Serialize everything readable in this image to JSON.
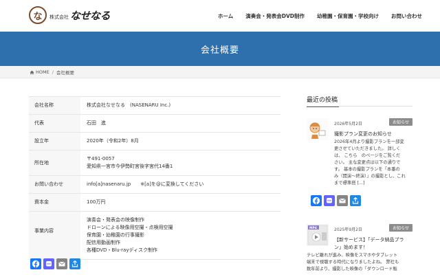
{
  "header": {
    "logo_mark": "な",
    "logo_sub": "株式会社",
    "logo_main": "なせなる",
    "nav": [
      "ホーム",
      "演奏会・発表会DVD制作",
      "幼稚園・保育園・学校向け",
      "お問い合わせ"
    ]
  },
  "banner": {
    "title": "会社概要"
  },
  "breadcrumb": {
    "home": "HOME",
    "sep": "/",
    "current": "会社概要"
  },
  "company": {
    "rows": [
      {
        "key": "会社名称",
        "values": [
          "株式会社なせなる　(NASENARU Inc.)"
        ]
      },
      {
        "key": "代表",
        "values": [
          "石田　進"
        ]
      },
      {
        "key": "設立年",
        "values": [
          "2020年（令和2年）8月"
        ]
      },
      {
        "key": "所在地",
        "values": [
          "〒491-0057",
          "愛知県一宮市今伊勢町宮後字宮代14番1"
        ]
      },
      {
        "key": "お問い合わせ",
        "values": [
          "info[a]nasenaru.jp　　※[a]を@に変換してください"
        ]
      },
      {
        "key": "資本金",
        "values": [
          "100万円"
        ]
      },
      {
        "key": "事業内容",
        "values": [
          "演奏会・発表会の映像制作",
          "ドローンによる映像用空撮・点検用空撮",
          "保育園・幼稚園の行事撮影",
          "配信用動画制作",
          "各種DVD・Blu-rayディスク制作"
        ]
      }
    ]
  },
  "share": [
    "facebook-icon",
    "mastodon-icon",
    "mail-icon",
    "share-icon"
  ],
  "sidebar": {
    "title": "最近の投稿",
    "posts": [
      {
        "date": "2026年5月2日",
        "badge": "お知らせ",
        "title": "撮影プラン変更のお知らせ",
        "excerpt": [
          "2026年4月より撮影プランを一部変",
          "更させていただきました。 詳しく",
          "は、 こちら　のページをご覧くだ",
          "さい。 主な変更点は以下の通りで",
          "す。 基本の撮影プランを「本番の",
          "み（開演〜終演）」の撮影とし、これ",
          "まで標準搭 [...]"
        ]
      },
      {
        "date": "2025年9月2日",
        "badge": "お知らせ",
        "title": "【新サービス】「データ納品プラ",
        "title2": "ン」始めます！",
        "thumb_label": "MP4",
        "excerpt": [
          "テレビ離れが進み、映像をスマホやタブレット",
          "端末で視聴する時代になりましたよね。 弊社も",
          "数年前より、撮影した映像の「ダウンロード販"
        ]
      }
    ]
  },
  "colors": {
    "banner": "#2e6fad",
    "badge": "#8c8c8c",
    "facebook": "#1877f2",
    "mastodon": "#6364ff",
    "mail": "#848484",
    "share": "#1f88e5"
  }
}
